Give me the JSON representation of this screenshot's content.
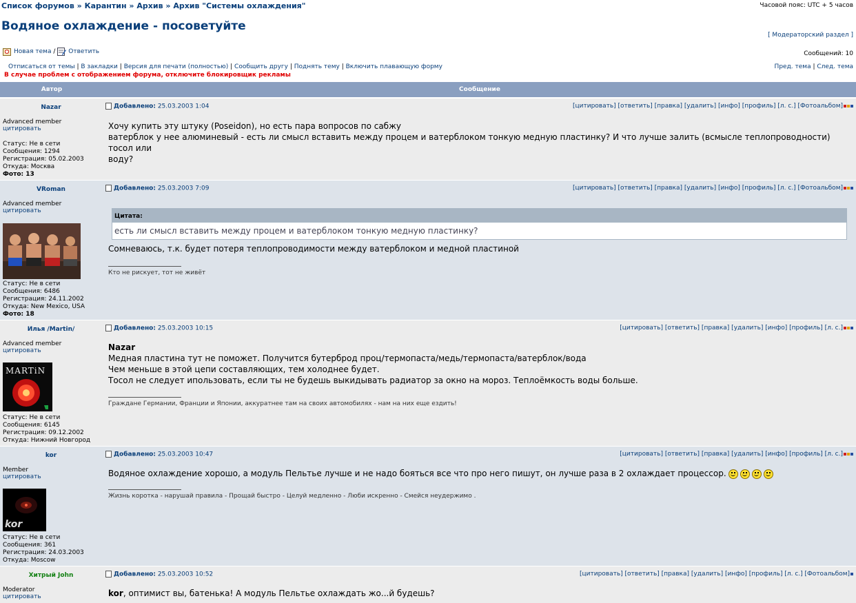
{
  "breadcrumb": {
    "forums": "Список форумов",
    "sep": "»",
    "quarantine": "Карантин",
    "archive": "Архив",
    "archive_cooling": "Архив \"Системы охлаждения\""
  },
  "timezone": "Часовой пояс: UTC + 5 часов",
  "topic_title": "Водяное охлаждение - посоветуйте",
  "moderator_link": "[ Модераторский раздел ]",
  "actions": {
    "new_topic": "Новая тема",
    "sep": "/",
    "reply": "Ответить"
  },
  "message_count": "Сообщений: 10",
  "topic_links": [
    "Отписаться от темы",
    "В закладки",
    "Версия для печати (полностью)",
    "Сообщить другу",
    "Поднять тему",
    "Включить плавающую форму"
  ],
  "nav": {
    "prev": "Пред. тема",
    "sep": "|",
    "next": "След. тема"
  },
  "warning": "В случае проблем с отображением форума, отключите блокировщик рекламы",
  "table_head": {
    "author": "Автор",
    "message": "Сообщение"
  },
  "cite_label": "цитировать",
  "added_label": "Добавлено:",
  "quote_label": "Цитата:",
  "buttons_full": "[цитировать] [ответить] [правка] [удалить] [инфо] [профиль] [л. с.] [Фотоальбом]",
  "buttons_short": "[цитировать] [ответить] [правка] [удалить] [инфо] [профиль] [л. с.]",
  "posts": [
    {
      "author": "Nazar",
      "rank": "Advanced member",
      "date": "25.03.2003 1:04",
      "stats": [
        "Статус: Не в сети",
        "Сообщения: 1294",
        "Регистрация: 05.02.2003",
        "Откуда: Москва"
      ],
      "photo": "Фото: 13",
      "text": [
        "Хочу купить эту штуку (Poseidon), но есть пара вопросов по сабжу",
        "ватерблок у нее алюминевый - есть ли смысл вставить между процем и ватерблоком тонкую медную пластинку? И что лучше залить (всмысле теплопроводности) тосол или",
        "воду?"
      ]
    },
    {
      "author": "VRoman",
      "rank": "Advanced member",
      "date": "25.03.2003 7:09",
      "stats": [
        "Статус: Не в сети",
        "Сообщения: 6486",
        "Регистрация: 24.11.2002",
        "Откуда: New Mexico, USA"
      ],
      "photo": "Фото: 18",
      "quote": "есть ли смысл вставить между процем и ватерблоком тонкую медную пластинку?",
      "text": [
        "Сомневаюсь, т.к. будет потеря теплопроводимости между ватерблоком и медной пластиной"
      ],
      "signature": "Кто не рискует, тот не живёт"
    },
    {
      "author": "Илья /Martin/",
      "rank": "Advanced member",
      "date": "25.03.2003 10:15",
      "avatar_text": "MARTiN",
      "stats": [
        "Статус: Не в сети",
        "Сообщения: 6145",
        "Регистрация: 09.12.2002",
        "Откуда: Нижний Новгород"
      ],
      "addressee": "Nazar",
      "text": [
        "Медная пластина тут не поможет. Получится бутерброд проц/термопаста/медь/термопаста/ватерблок/вода",
        "Чем меньше в этой цепи составляющих, тем холоднее будет.",
        "Тосол не следует ипользовать, если ты не будешь выкидывать радиатор за окно на мороз. Теплоёмкость воды больше."
      ],
      "signature": "Граждане Германии, Франции и Японии, аккуратнее там на своих автомобилях - нам на них еще ездить!"
    },
    {
      "author": "kor",
      "rank": "Member",
      "date": "25.03.2003 10:47",
      "avatar_text": "kor",
      "stats": [
        "Статус: Не в сети",
        "Сообщения: 361",
        "Регистрация: 24.03.2003",
        "Откуда: Moscow"
      ],
      "text": [
        "Водяное охлаждение хорошо, а модуль Пельтье лучше и не надо бояться все что про него пишут, он лучше раза в 2 охлаждает процессор."
      ],
      "signature": "Жизнь коротка - нарушай правила - Прощай быстро - Целуй медленно - Люби искренно - Смейся неудержимо ."
    },
    {
      "author": "Хитрый John",
      "rank": "Moderator",
      "date": "25.03.2003 10:52",
      "addressee": "kor",
      "text": [
        ", оптимист вы, батенька! А модуль Пельтье охлаждать жо...й будешь?"
      ]
    }
  ]
}
